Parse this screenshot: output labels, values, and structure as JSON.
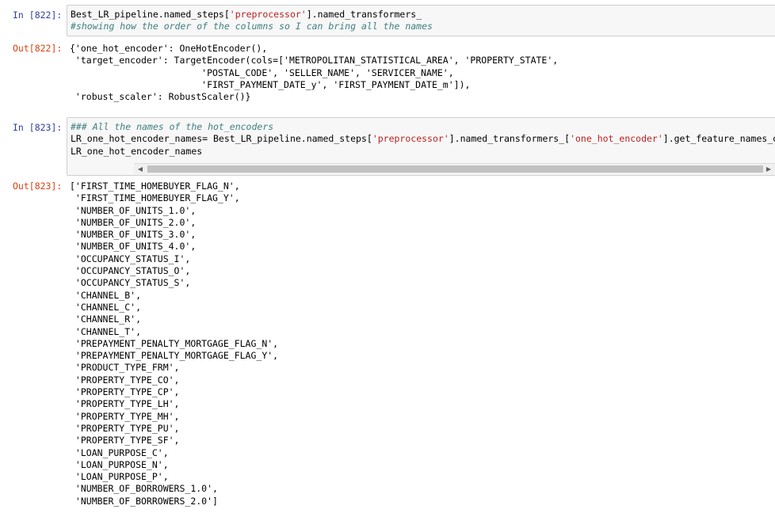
{
  "cells": [
    {
      "in_prompt": "In [822]:",
      "code": [
        "Best_LR_pipeline.named_steps[",
        "'preprocessor'",
        "].named_transformers_"
      ],
      "comment": "#showing how the order of the columns so I can bring all the names",
      "out_prompt": "Out[822]:",
      "output_lines": [
        "{'one_hot_encoder': OneHotEncoder(),",
        " 'target_encoder': TargetEncoder(cols=['METROPOLITAN_STATISTICAL_AREA', 'PROPERTY_STATE',",
        "                        'POSTAL_CODE', 'SELLER_NAME', 'SERVICER_NAME',",
        "                        'FIRST_PAYMENT_DATE_y', 'FIRST_PAYMENT_DATE_m']),",
        " 'robust_scaler': RobustScaler()}"
      ]
    },
    {
      "in_prompt": "In [823]:",
      "comment": "### All the names of the hot_encoders",
      "code_line2": [
        "LR_one_hot_encoder_names= Best_LR_pipeline.named_steps[",
        "'preprocessor'",
        "].named_transformers_[",
        "'one_hot_encoder'",
        "].get_feature_names_o"
      ],
      "code_line3": "LR_one_hot_encoder_names",
      "scroll_left": "◀",
      "scroll_right": "▶",
      "out_prompt": "Out[823]:",
      "output_lines": [
        "['FIRST_TIME_HOMEBUYER_FLAG_N',",
        " 'FIRST_TIME_HOMEBUYER_FLAG_Y',",
        " 'NUMBER_OF_UNITS_1.0',",
        " 'NUMBER_OF_UNITS_2.0',",
        " 'NUMBER_OF_UNITS_3.0',",
        " 'NUMBER_OF_UNITS_4.0',",
        " 'OCCUPANCY_STATUS_I',",
        " 'OCCUPANCY_STATUS_O',",
        " 'OCCUPANCY_STATUS_S',",
        " 'CHANNEL_B',",
        " 'CHANNEL_C',",
        " 'CHANNEL_R',",
        " 'CHANNEL_T',",
        " 'PREPAYMENT_PENALTY_MORTGAGE_FLAG_N',",
        " 'PREPAYMENT_PENALTY_MORTGAGE_FLAG_Y',",
        " 'PRODUCT_TYPE_FRM',",
        " 'PROPERTY_TYPE_CO',",
        " 'PROPERTY_TYPE_CP',",
        " 'PROPERTY_TYPE_LH',",
        " 'PROPERTY_TYPE_MH',",
        " 'PROPERTY_TYPE_PU',",
        " 'PROPERTY_TYPE_SF',",
        " 'LOAN_PURPOSE_C',",
        " 'LOAN_PURPOSE_N',",
        " 'LOAN_PURPOSE_P',",
        " 'NUMBER_OF_BORROWERS_1.0',",
        " 'NUMBER_OF_BORROWERS_2.0']"
      ]
    }
  ]
}
